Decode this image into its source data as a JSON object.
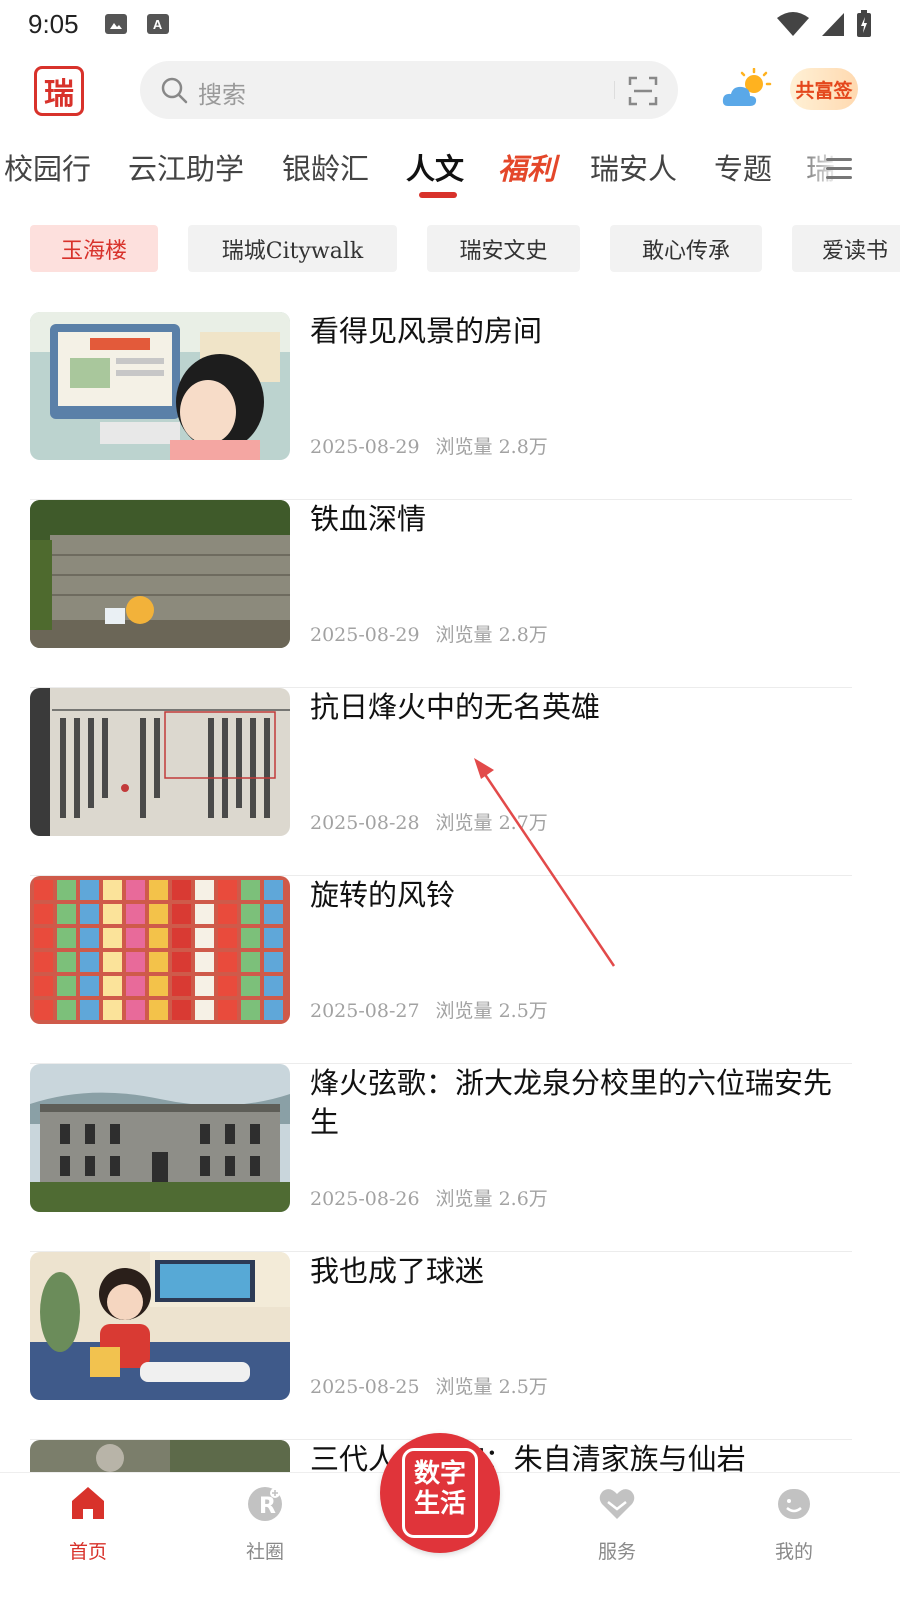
{
  "status_bar": {
    "time": "9:05"
  },
  "header": {
    "logo_text": "瑞",
    "search": {
      "placeholder": "搜索"
    },
    "badge_text": "共富签"
  },
  "channel_tabs": {
    "items": [
      "校园行",
      "云江助学",
      "银龄汇",
      "人文",
      "福利",
      "瑞安人",
      "专题",
      "瑞"
    ],
    "active": "人文"
  },
  "sub_tabs": {
    "items": [
      "玉海楼",
      "瑞城Citywalk",
      "瑞安文史",
      "敢心传承",
      "爱读书"
    ],
    "active": "玉海楼"
  },
  "articles": [
    {
      "title": "看得见风景的房间",
      "date": "2025-08-29",
      "views": "浏览量 2.8万"
    },
    {
      "title": "铁血深情",
      "date": "2025-08-29",
      "views": "浏览量 2.8万"
    },
    {
      "title": "抗日烽火中的无名英雄",
      "date": "2025-08-28",
      "views": "浏览量 2.7万"
    },
    {
      "title": "旋转的风铃",
      "date": "2025-08-27",
      "views": "浏览量 2.5万"
    },
    {
      "title": "烽火弦歌：浙大龙泉分校里的六位瑞安先生",
      "date": "2025-08-26",
      "views": "浏览量 2.6万"
    },
    {
      "title": "我也成了球迷",
      "date": "2025-08-25",
      "views": "浏览量 2.5万"
    },
    {
      "title": "三代人“寻”踪：朱自清家族与仙岩",
      "date": "",
      "views": ""
    }
  ],
  "bottom_nav": {
    "items": [
      {
        "label": "首页",
        "icon": "home-icon",
        "active": true
      },
      {
        "label": "社圈",
        "icon": "community-icon",
        "active": false
      },
      {
        "label": "服务",
        "icon": "service-icon",
        "active": false
      },
      {
        "label": "我的",
        "icon": "profile-icon",
        "active": false
      }
    ],
    "center_button_text": "数字生活"
  },
  "colors": {
    "accent": "#d8322b",
    "active_chip_bg": "#fde0dd",
    "meta_text": "#a2a2a2"
  }
}
